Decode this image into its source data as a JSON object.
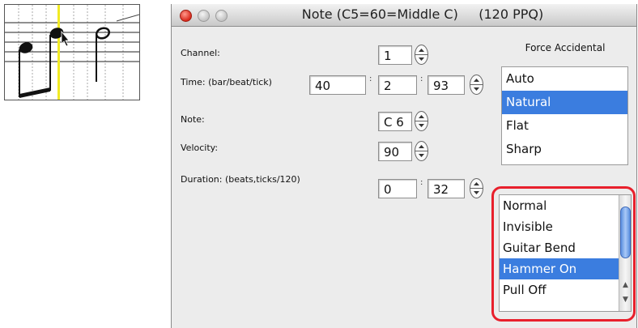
{
  "window": {
    "title": "Note (C5=60=Middle C)     (120 PPQ)",
    "buttons": [
      "close",
      "minimize",
      "zoom"
    ]
  },
  "fields": {
    "channel": {
      "label": "Channel:",
      "value": "1"
    },
    "time": {
      "label": "Time: (bar/beat/tick)",
      "bar": "40",
      "beat": "2",
      "tick": "93"
    },
    "note": {
      "label": "Note:",
      "value": "C 6"
    },
    "velocity": {
      "label": "Velocity:",
      "value": "90"
    },
    "duration": {
      "label": "Duration: (beats,ticks/120)",
      "beats": "0",
      "ticks": "32"
    },
    "separator": ":"
  },
  "accidental": {
    "label": "Force Accidental",
    "options": [
      "Auto",
      "Natural",
      "Flat",
      "Sharp"
    ],
    "selected": "Natural"
  },
  "notation_type": {
    "options": [
      "Normal",
      "Invisible",
      "Guitar Bend",
      "Hammer On",
      "Pull Off"
    ],
    "selected": "Hammer On"
  },
  "icons": [
    "stepper-icon",
    "scroll-up-icon",
    "scroll-down-icon",
    "cursor-arrow-icon"
  ],
  "colors": {
    "selection": "#3b7ddf",
    "highlight_ring": "#e8202c",
    "playhead": "#f1ea24",
    "close": "#d8281b"
  }
}
